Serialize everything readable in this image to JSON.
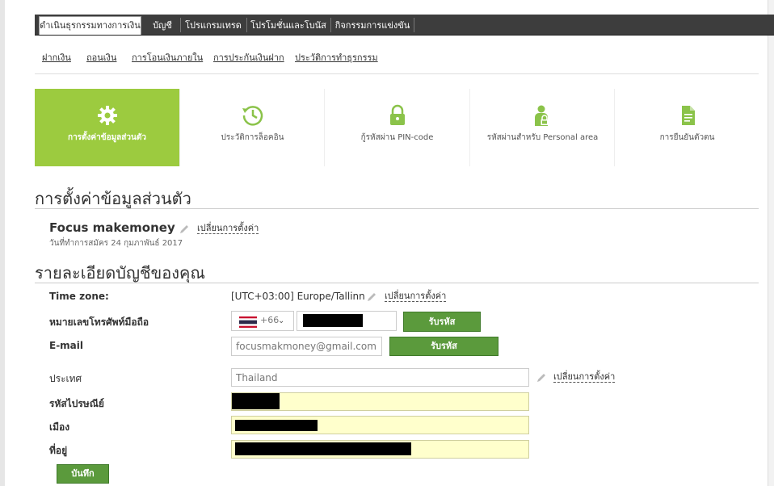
{
  "tabs": [
    {
      "label": "ดำเนินธุรกรรมทางการเงิน",
      "active": true
    },
    {
      "label": "บัญชี",
      "active": false
    },
    {
      "label": "โปรแกรมเทรด",
      "active": false
    },
    {
      "label": "โปรโมชั่นและโบนัส",
      "active": false
    },
    {
      "label": "กิจกรรมการแข่งขัน",
      "active": false
    }
  ],
  "subnav": [
    "ฝากเงิน",
    "ถอนเงิน",
    "การโอนเงินภายใน",
    "การประกันเงินฝาก",
    "ประวัติการทำธุรกรรม"
  ],
  "tiles": [
    {
      "label": "การตั้งค่าข้อมูลส่วนตัว",
      "icon": "gear-icon",
      "active": true
    },
    {
      "label": "ประวัติการล็อคอิน",
      "icon": "clock-history-icon",
      "active": false
    },
    {
      "label": "กู้รหัสผ่าน PIN-code",
      "icon": "lock-icon",
      "active": false
    },
    {
      "label": "รหัสผ่านสำหรับ Personal area",
      "icon": "user-lock-icon",
      "active": false
    },
    {
      "label": "การยืนยันตัวตน",
      "icon": "document-icon",
      "active": false
    }
  ],
  "personal": {
    "heading": "การตั้งค่าข้อมูลส่วนตัว",
    "username": "Focus makemoney",
    "change_label": "เปลี่ยนการตั้งค่า",
    "reg_date": "วันที่ทำการสมัคร 24 กุมภาพันธ์ 2017"
  },
  "account": {
    "heading": "รายละเอียดบัญชีของคุณ",
    "timezone_label": "Time zone:",
    "timezone_value": "[UTC+03:00] Europe/Tallinn",
    "timezone_change": "เปลี่ยนการตั้งค่า",
    "phone_label": "หมายเลขโทรศัพท์มือถือ",
    "phone_code": "+66",
    "phone_button": "รับรหัส",
    "email_label": "E-mail",
    "email_value": "focusmakmoney@gmail.com",
    "email_button": "รับรหัส",
    "country_label": "ประเทศ",
    "country_value": "Thailand",
    "country_change": "เปลี่ยนการตั้งค่า",
    "postcode_label": "รหัสไปรษณีย์",
    "city_label": "เมือง",
    "address_label": "ที่อยู่",
    "save_button": "บันทึก"
  },
  "colors": {
    "active_tile": "#9ccb3f",
    "button_green": "#5b9a3c",
    "topbar": "#3d3d3d",
    "input_yellow": "#ffffcc"
  }
}
